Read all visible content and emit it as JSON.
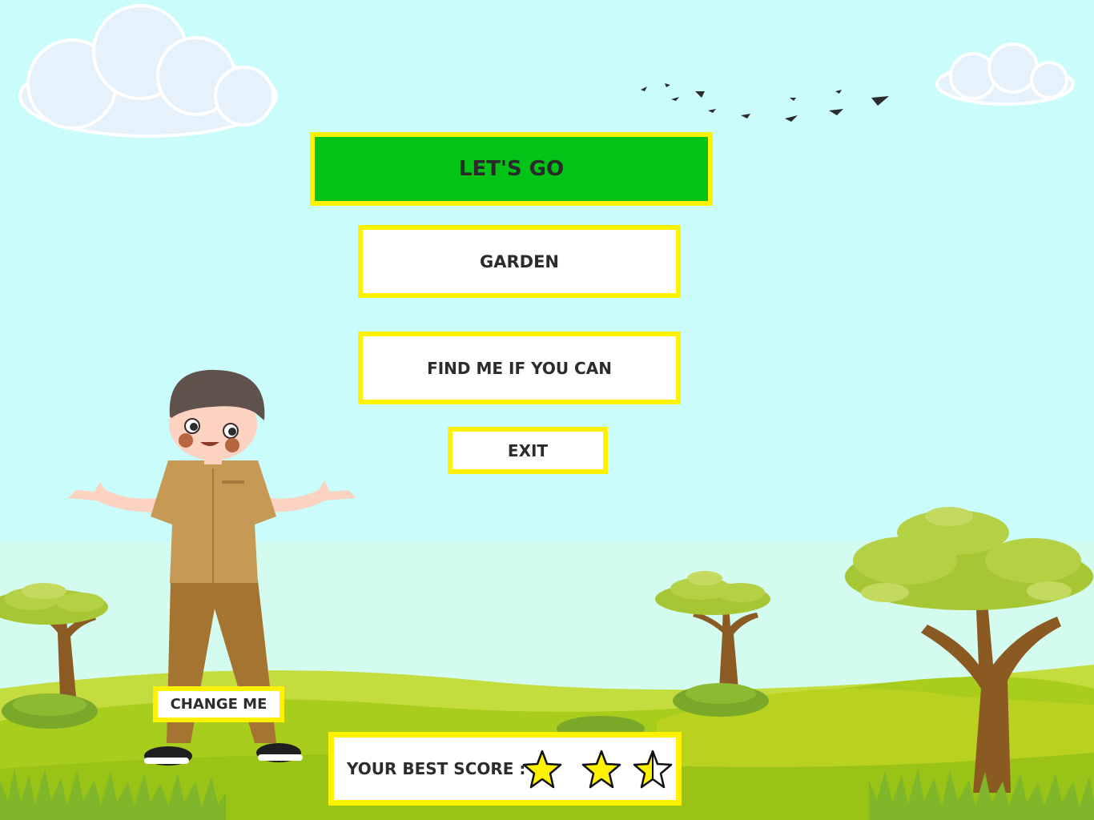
{
  "menu": {
    "lets_go": "LET'S GO",
    "garden": "GARDEN",
    "find_me": "FIND ME IF YOU CAN",
    "exit": "EXIT"
  },
  "character": {
    "change_label": "CHANGE ME"
  },
  "score": {
    "label": "YOUR BEST SCORE  :",
    "stars_total": 3,
    "stars_earned": 2.5
  },
  "colors": {
    "sky": "#c9fcfb",
    "primary_button": "#03c317",
    "button_border": "#fff200",
    "star_fill": "#fff200"
  }
}
